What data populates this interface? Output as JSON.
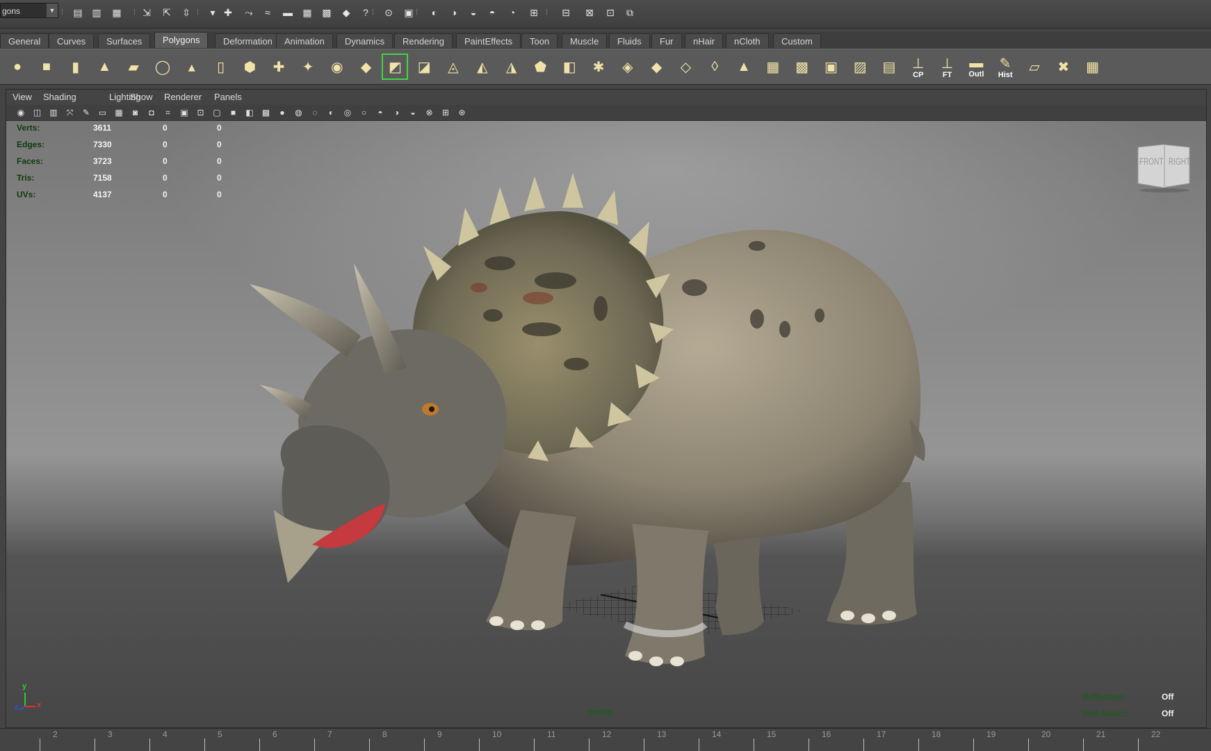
{
  "status_bar": {
    "menu_set": "gons",
    "icons": [
      "new-scene-icon",
      "open-scene-icon",
      "save-scene-icon",
      "select-hierarchy-icon",
      "select-object-icon",
      "select-component-icon",
      "filter-icon",
      "snap-grid-icon",
      "snap-curve-icon",
      "snap-point-icon",
      "snap-plane-icon",
      "snap-live-icon",
      "history-icon",
      "construction-history-icon",
      "help-icon",
      "lock-icon",
      "render-region-icon",
      "render-icon",
      "ipr-icon",
      "render-settings-icon",
      "hypershade-icon",
      "render-view-icon",
      "magnet-icon",
      "script-editor-icon",
      "attribute-editor-icon",
      "tool-settings-icon",
      "channel-box-icon"
    ]
  },
  "shelf_tabs": [
    "General",
    "Curves",
    "Surfaces",
    "Polygons",
    "Deformation",
    "Animation",
    "Dynamics",
    "Rendering",
    "PaintEffects",
    "Toon",
    "Muscle",
    "Fluids",
    "Fur",
    "nHair",
    "nCloth",
    "Custom"
  ],
  "active_shelf_tab": "Polygons",
  "shelf_icons": [
    {
      "name": "poly-sphere-icon",
      "glyph": "●",
      "label": ""
    },
    {
      "name": "poly-cube-icon",
      "glyph": "■",
      "label": ""
    },
    {
      "name": "poly-cylinder-icon",
      "glyph": "▮",
      "label": ""
    },
    {
      "name": "poly-cone-icon",
      "glyph": "▲",
      "label": ""
    },
    {
      "name": "poly-plane-icon",
      "glyph": "▰",
      "label": ""
    },
    {
      "name": "poly-torus-icon",
      "glyph": "◯",
      "label": ""
    },
    {
      "name": "poly-pyramid-icon",
      "glyph": "▴",
      "label": ""
    },
    {
      "name": "poly-pipe-icon",
      "glyph": "▯",
      "label": ""
    },
    {
      "name": "poly-soccerball-icon",
      "glyph": "⬢",
      "label": ""
    },
    {
      "name": "combine-icon",
      "glyph": "✚",
      "label": ""
    },
    {
      "name": "separate-icon",
      "glyph": "✦",
      "label": ""
    },
    {
      "name": "smooth-icon",
      "glyph": "◉",
      "label": ""
    },
    {
      "name": "proxy-cube-icon",
      "glyph": "◆",
      "label": ""
    },
    {
      "name": "extrude-icon",
      "glyph": "◩",
      "label": ""
    },
    {
      "name": "bridge-icon",
      "glyph": "◪",
      "label": ""
    },
    {
      "name": "append-polygon-icon",
      "glyph": "◬",
      "label": ""
    },
    {
      "name": "split-polygon-icon",
      "glyph": "◭",
      "label": ""
    },
    {
      "name": "insert-edge-loop-icon",
      "glyph": "◮",
      "label": ""
    },
    {
      "name": "offset-edge-loop-icon",
      "glyph": "⬟",
      "label": ""
    },
    {
      "name": "cut-faces-icon",
      "glyph": "◧",
      "label": ""
    },
    {
      "name": "merge-vertices-icon",
      "glyph": "✱",
      "label": ""
    },
    {
      "name": "bevel-icon",
      "glyph": "◈",
      "label": ""
    },
    {
      "name": "wedge-icon",
      "glyph": "◆",
      "label": ""
    },
    {
      "name": "poke-icon",
      "glyph": "◇",
      "label": ""
    },
    {
      "name": "chamfer-icon",
      "glyph": "◊",
      "label": ""
    },
    {
      "name": "sculpt-icon",
      "glyph": "▲",
      "label": ""
    },
    {
      "name": "uv-planar-icon",
      "glyph": "▦",
      "label": ""
    },
    {
      "name": "uv-cylindrical-icon",
      "glyph": "▩",
      "label": ""
    },
    {
      "name": "uv-spherical-icon",
      "glyph": "▣",
      "label": ""
    },
    {
      "name": "uv-auto-icon",
      "glyph": "▨",
      "label": ""
    },
    {
      "name": "uv-editor-icon",
      "glyph": "▤",
      "label": ""
    },
    {
      "name": "center-pivot-icon",
      "glyph": "⊥",
      "label": "CP"
    },
    {
      "name": "freeze-transform-icon",
      "glyph": "⊥",
      "label": "FT"
    },
    {
      "name": "outliner-icon",
      "glyph": "▬",
      "label": "Outl"
    },
    {
      "name": "history-icon",
      "glyph": "✎",
      "label": "Hist"
    },
    {
      "name": "texture-editor-icon",
      "glyph": "▱",
      "label": ""
    },
    {
      "name": "delete-history-icon",
      "glyph": "✖",
      "label": ""
    },
    {
      "name": "grid-icon",
      "glyph": "▦",
      "label": ""
    }
  ],
  "panel": {
    "menus": [
      "View",
      "Shading",
      "Lighting",
      "Show",
      "Renderer",
      "Panels"
    ],
    "toolbar_icons": [
      "camera-attr-icon",
      "bookmark-icon",
      "image-plane-icon",
      "2d-pan-icon",
      "grease-pencil-icon",
      "gate-icon",
      "resolution-gate-icon",
      "safe-action-icon",
      "safe-title-icon",
      "field-chart-icon",
      "film-gate-icon",
      "isolate-select-icon",
      "wireframe-icon",
      "smooth-shade-icon",
      "wireframe-on-shaded-icon",
      "textured-icon",
      "use-all-lights-icon",
      "shadows-icon",
      "screen-space-ao-icon",
      "motion-blur-icon",
      "multisample-icon",
      "depth-of-field-icon",
      "xray-icon",
      "xray-joints-icon",
      "backface-culling-icon",
      "isolate-icon",
      "grid-icon",
      "hud-icon"
    ]
  },
  "hud": {
    "rows": [
      {
        "label": "Verts:",
        "v1": "3611",
        "v2": "0",
        "v3": "0"
      },
      {
        "label": "Edges:",
        "v1": "7330",
        "v2": "0",
        "v3": "0"
      },
      {
        "label": "Faces:",
        "v1": "3723",
        "v2": "0",
        "v3": "0"
      },
      {
        "label": "Tris:",
        "v1": "7158",
        "v2": "0",
        "v3": "0"
      },
      {
        "label": "UVs:",
        "v1": "4137",
        "v2": "0",
        "v3": "0"
      }
    ],
    "camera": "persp",
    "reflection_label": "Reflection:",
    "reflection_value": "Off",
    "soft_select_label": "Soft Select:",
    "soft_select_value": "Off"
  },
  "viewcube": {
    "front": "FRONT",
    "right": "RIGHT"
  },
  "axis": {
    "x": "x",
    "y": "y",
    "z": "z"
  },
  "time_slider": {
    "labels": [
      "2",
      "3",
      "4",
      "5",
      "6",
      "7",
      "8",
      "9",
      "10",
      "11",
      "12",
      "13",
      "14",
      "15",
      "16",
      "17",
      "18",
      "19",
      "20",
      "21",
      "22"
    ]
  },
  "colors": {
    "hud_label": "#0e3a0e",
    "active_tab": "#5c5c5c",
    "select_green": "#3ed83e"
  }
}
